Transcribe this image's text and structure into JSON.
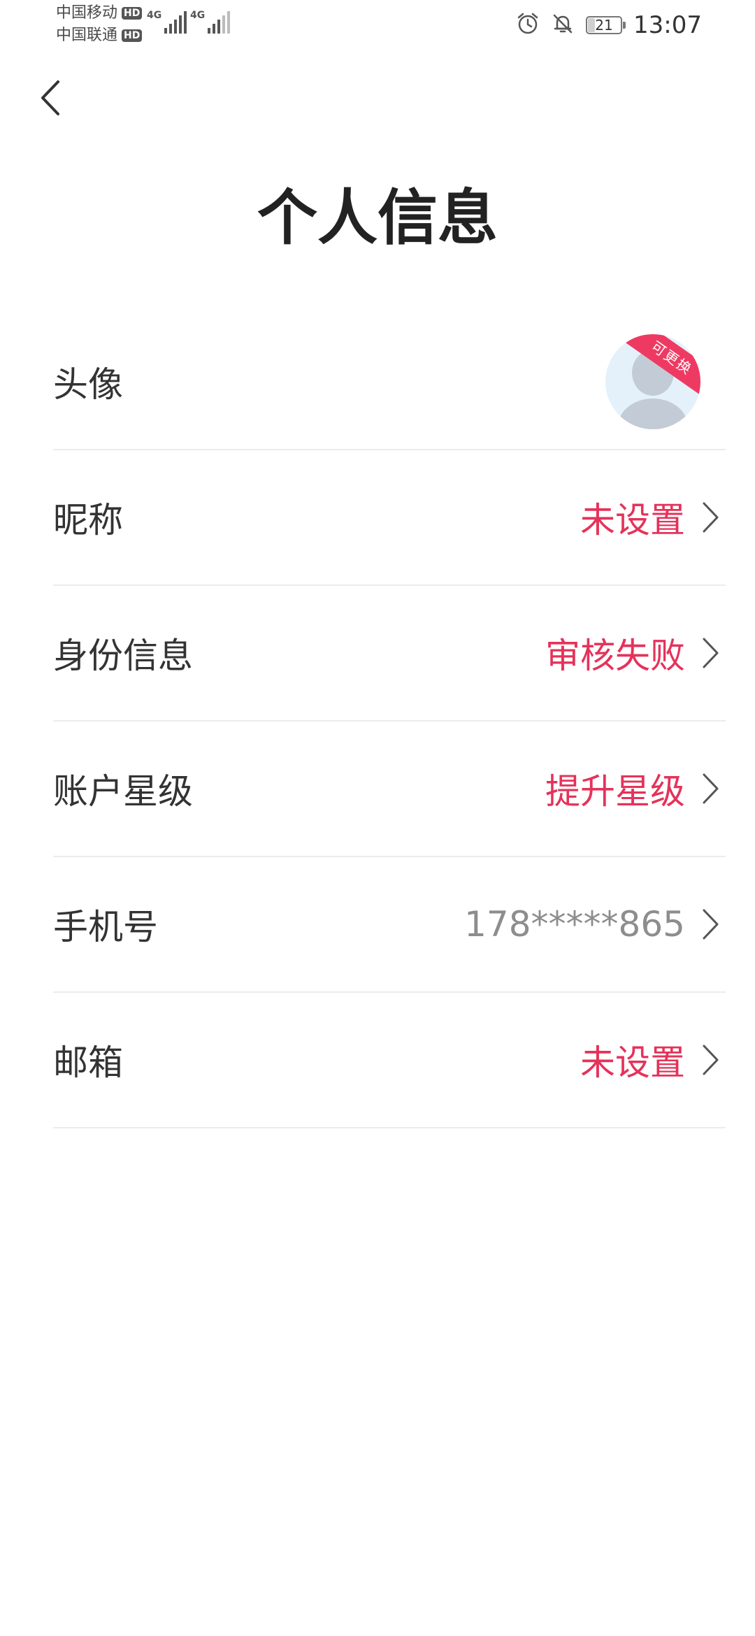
{
  "status_bar": {
    "carrier1": "中国移动",
    "carrier2": "中国联通",
    "hd": "HD",
    "network1": "4G",
    "network2": "4G",
    "battery": "21",
    "time": "13:07",
    "icons": [
      "alarm-icon",
      "mute-icon",
      "battery-icon"
    ]
  },
  "header": {
    "back_icon": "chevron-left-icon",
    "title": "个人信息"
  },
  "rows": {
    "avatar": {
      "label": "头像",
      "badge": "可更换"
    },
    "nickname": {
      "label": "昵称",
      "value": "未设置"
    },
    "identity": {
      "label": "身份信息",
      "value": "审核失败"
    },
    "account_level": {
      "label": "账户星级",
      "value": "提升星级"
    },
    "phone": {
      "label": "手机号",
      "value": "178*****865"
    },
    "email": {
      "label": "邮箱",
      "value": "未设置"
    }
  },
  "colors": {
    "accent": "#e5325a",
    "muted": "#8d8d8d",
    "divider": "#ececec"
  }
}
